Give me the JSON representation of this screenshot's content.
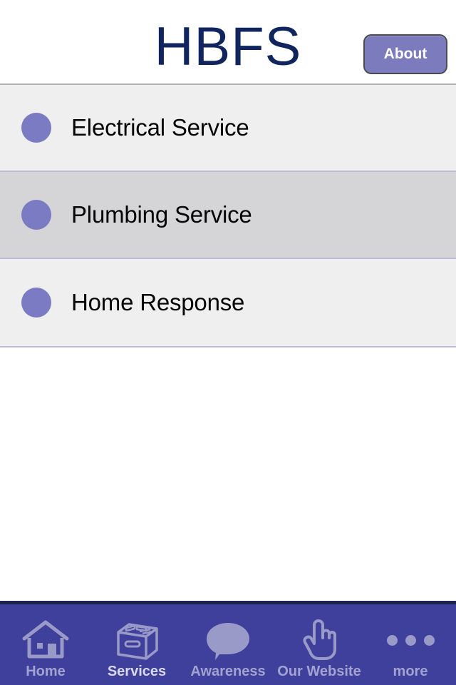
{
  "header": {
    "title": "HBFS",
    "title_color": "#10255e",
    "about_label": "About",
    "about_bg": "#7b7bbe"
  },
  "services": {
    "items": [
      {
        "label": "Electrical Service",
        "bullet_icon": "circle-bullet-icon",
        "selected": false
      },
      {
        "label": "Plumbing Service",
        "bullet_icon": "circle-bullet-icon",
        "selected": true
      },
      {
        "label": "Home Response",
        "bullet_icon": "circle-bullet-icon",
        "selected": false
      }
    ],
    "bullet_color": "#7b7bc4",
    "row_bg": "#efefef",
    "row_selected_bg": "#d5d5d8",
    "separator_color": "#bcbcd8"
  },
  "tabbar": {
    "bg": "#3f3f9c",
    "top_border": "#1e2350",
    "active_index": 1,
    "tabs": [
      {
        "label": "Home",
        "icon": "house-icon"
      },
      {
        "label": "Services",
        "icon": "file-box-icon"
      },
      {
        "label": "Awareness",
        "icon": "speech-bubble-icon"
      },
      {
        "label": "Our Website",
        "icon": "pointing-hand-icon"
      },
      {
        "label": "more",
        "icon": "ellipsis-icon"
      }
    ]
  }
}
